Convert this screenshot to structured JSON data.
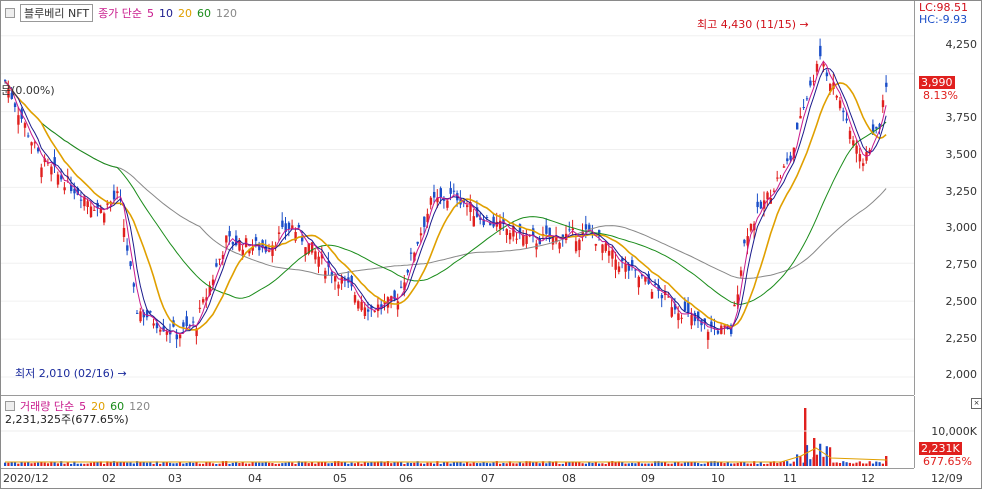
{
  "price_legend": {
    "name": "블루베리 NFT",
    "ma_label": "종가 단순",
    "periods": [
      "5",
      "10",
      "20",
      "60",
      "120"
    ],
    "period_colors": [
      "#c8198c",
      "#1a1a8c",
      "#e0a000",
      "#1a8c1a",
      "#888888"
    ]
  },
  "volume_legend": {
    "label": "거래량 단순",
    "periods": [
      "5",
      "20",
      "60",
      "120"
    ],
    "period_colors": [
      "#c8198c",
      "#e0a000",
      "#1a8c1a",
      "#888888"
    ],
    "current": "2,231,325주(677.65%)"
  },
  "price_axis": {
    "lc": "LC:98.51",
    "hc": "HC:-9.93",
    "ticks": [
      "4,250",
      "4,000",
      "3,750",
      "3,500",
      "3,250",
      "3,000",
      "2,750",
      "2,500",
      "2,250",
      "2,000"
    ],
    "current_price": "3,990",
    "change_pct": "8.13%"
  },
  "volume_axis": {
    "tick": "10,000K",
    "current": "2,231K",
    "pct": "677.65%"
  },
  "annotations": {
    "high": "최고 4,430 (11/15)",
    "low": "최저 2,010 (02/16)",
    "ref": "(0.00%)"
  },
  "x_axis": [
    "2020/12",
    "02",
    "03",
    "04",
    "05",
    "06",
    "07",
    "08",
    "09",
    "10",
    "11",
    "12",
    "12/09"
  ],
  "colors": {
    "up": "#e0201e",
    "down": "#1a4ec8",
    "ma5": "#c8198c",
    "ma10": "#1a1a8c",
    "ma20": "#e0a000",
    "ma60": "#1a8c1a",
    "ma120": "#888888"
  }
}
